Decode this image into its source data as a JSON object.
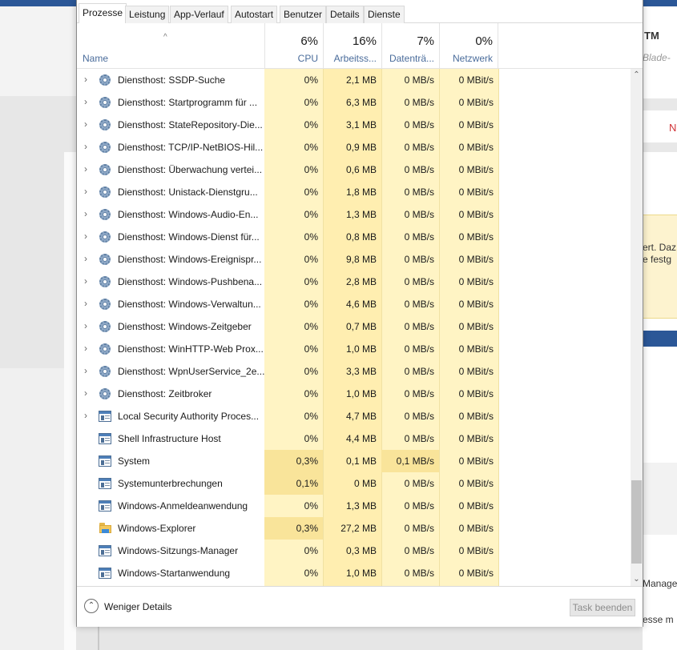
{
  "tabs": [
    "Prozesse",
    "Leistung",
    "App-Verlauf",
    "Autostart",
    "Benutzer",
    "Details",
    "Dienste"
  ],
  "active_tab": "Prozesse",
  "header": {
    "name_label": "Name",
    "sort_indicator": "^",
    "cpu": {
      "percent": "6%",
      "label": "CPU"
    },
    "memory": {
      "percent": "16%",
      "label": "Arbeitss..."
    },
    "disk": {
      "percent": "7%",
      "label": "Datenträ..."
    },
    "network": {
      "percent": "0%",
      "label": "Netzwerk"
    }
  },
  "heat_colors": {
    "light": "#fff4c4",
    "medium": "#ffeeb0",
    "strong": "#f9e49a"
  },
  "processes": [
    {
      "name": "Diensthost: SSDP-Suche",
      "icon": "gear-icon",
      "expandable": true,
      "cpu": "0%",
      "memory": "2,1 MB",
      "disk": "0 MB/s",
      "network": "0 MBit/s"
    },
    {
      "name": "Diensthost: Startprogramm für ...",
      "icon": "gear-icon",
      "expandable": true,
      "cpu": "0%",
      "memory": "6,3 MB",
      "disk": "0 MB/s",
      "network": "0 MBit/s"
    },
    {
      "name": "Diensthost: StateRepository-Die...",
      "icon": "gear-icon",
      "expandable": true,
      "cpu": "0%",
      "memory": "3,1 MB",
      "disk": "0 MB/s",
      "network": "0 MBit/s"
    },
    {
      "name": "Diensthost: TCP/IP-NetBIOS-Hil...",
      "icon": "gear-icon",
      "expandable": true,
      "cpu": "0%",
      "memory": "0,9 MB",
      "disk": "0 MB/s",
      "network": "0 MBit/s"
    },
    {
      "name": "Diensthost: Überwachung vertei...",
      "icon": "gear-icon",
      "expandable": true,
      "cpu": "0%",
      "memory": "0,6 MB",
      "disk": "0 MB/s",
      "network": "0 MBit/s"
    },
    {
      "name": "Diensthost: Unistack-Dienstgru...",
      "icon": "gear-icon",
      "expandable": true,
      "cpu": "0%",
      "memory": "1,8 MB",
      "disk": "0 MB/s",
      "network": "0 MBit/s"
    },
    {
      "name": "Diensthost: Windows-Audio-En...",
      "icon": "gear-icon",
      "expandable": true,
      "cpu": "0%",
      "memory": "1,3 MB",
      "disk": "0 MB/s",
      "network": "0 MBit/s"
    },
    {
      "name": "Diensthost: Windows-Dienst für...",
      "icon": "gear-icon",
      "expandable": true,
      "cpu": "0%",
      "memory": "0,8 MB",
      "disk": "0 MB/s",
      "network": "0 MBit/s"
    },
    {
      "name": "Diensthost: Windows-Ereignispr...",
      "icon": "gear-icon",
      "expandable": true,
      "cpu": "0%",
      "memory": "9,8 MB",
      "disk": "0 MB/s",
      "network": "0 MBit/s"
    },
    {
      "name": "Diensthost: Windows-Pushbena...",
      "icon": "gear-icon",
      "expandable": true,
      "cpu": "0%",
      "memory": "2,8 MB",
      "disk": "0 MB/s",
      "network": "0 MBit/s"
    },
    {
      "name": "Diensthost: Windows-Verwaltun...",
      "icon": "gear-icon",
      "expandable": true,
      "cpu": "0%",
      "memory": "4,6 MB",
      "disk": "0 MB/s",
      "network": "0 MBit/s"
    },
    {
      "name": "Diensthost: Windows-Zeitgeber",
      "icon": "gear-icon",
      "expandable": true,
      "cpu": "0%",
      "memory": "0,7 MB",
      "disk": "0 MB/s",
      "network": "0 MBit/s"
    },
    {
      "name": "Diensthost: WinHTTP-Web Prox...",
      "icon": "gear-icon",
      "expandable": true,
      "cpu": "0%",
      "memory": "1,0 MB",
      "disk": "0 MB/s",
      "network": "0 MBit/s"
    },
    {
      "name": "Diensthost: WpnUserService_2e...",
      "icon": "gear-icon",
      "expandable": true,
      "cpu": "0%",
      "memory": "3,3 MB",
      "disk": "0 MB/s",
      "network": "0 MBit/s"
    },
    {
      "name": "Diensthost: Zeitbroker",
      "icon": "gear-icon",
      "expandable": true,
      "cpu": "0%",
      "memory": "1,0 MB",
      "disk": "0 MB/s",
      "network": "0 MBit/s"
    },
    {
      "name": "Local Security Authority Proces...",
      "icon": "app-window-icon",
      "expandable": true,
      "cpu": "0%",
      "memory": "4,7 MB",
      "disk": "0 MB/s",
      "network": "0 MBit/s"
    },
    {
      "name": "Shell Infrastructure Host",
      "icon": "app-window-icon",
      "expandable": false,
      "cpu": "0%",
      "memory": "4,4 MB",
      "disk": "0 MB/s",
      "network": "0 MBit/s"
    },
    {
      "name": "System",
      "icon": "app-window-icon",
      "expandable": false,
      "cpu": "0,3%",
      "memory": "0,1 MB",
      "disk": "0,1 MB/s",
      "network": "0 MBit/s"
    },
    {
      "name": "Systemunterbrechungen",
      "icon": "app-window-icon",
      "expandable": false,
      "cpu": "0,1%",
      "memory": "0 MB",
      "disk": "0 MB/s",
      "network": "0 MBit/s"
    },
    {
      "name": "Windows-Anmeldeanwendung",
      "icon": "app-window-icon",
      "expandable": false,
      "cpu": "0%",
      "memory": "1,3 MB",
      "disk": "0 MB/s",
      "network": "0 MBit/s"
    },
    {
      "name": "Windows-Explorer",
      "icon": "folder-icon",
      "expandable": false,
      "cpu": "0,3%",
      "memory": "27,2 MB",
      "disk": "0 MB/s",
      "network": "0 MBit/s"
    },
    {
      "name": "Windows-Sitzungs-Manager",
      "icon": "app-window-icon",
      "expandable": false,
      "cpu": "0%",
      "memory": "0,3 MB",
      "disk": "0 MB/s",
      "network": "0 MBit/s"
    },
    {
      "name": "Windows-Startanwendung",
      "icon": "app-window-icon",
      "expandable": false,
      "cpu": "0%",
      "memory": "1,0 MB",
      "disk": "0 MB/s",
      "network": "0 MBit/s"
    }
  ],
  "footer": {
    "fewer_details": "Weniger Details",
    "end_task": "Task beenden"
  },
  "background_app": {
    "tm_fragment": "TM",
    "blade_fragment": "Blade-",
    "n_fragment": "N",
    "info_line_1": "ert. Daz",
    "info_line_2": "e festg",
    "manage_fragment": "Manage",
    "messe_fragment": "esse m"
  }
}
